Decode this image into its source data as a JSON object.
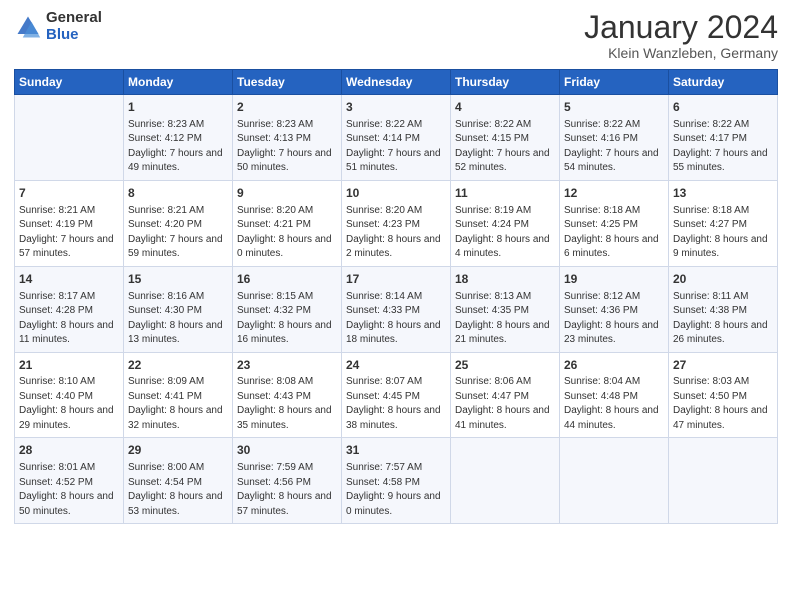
{
  "logo": {
    "general": "General",
    "blue": "Blue"
  },
  "title": "January 2024",
  "location": "Klein Wanzleben, Germany",
  "days": [
    "Sunday",
    "Monday",
    "Tuesday",
    "Wednesday",
    "Thursday",
    "Friday",
    "Saturday"
  ],
  "weeks": [
    [
      {
        "date": "",
        "sunrise": "",
        "sunset": "",
        "daylight": ""
      },
      {
        "date": "1",
        "sunrise": "Sunrise: 8:23 AM",
        "sunset": "Sunset: 4:12 PM",
        "daylight": "Daylight: 7 hours and 49 minutes."
      },
      {
        "date": "2",
        "sunrise": "Sunrise: 8:23 AM",
        "sunset": "Sunset: 4:13 PM",
        "daylight": "Daylight: 7 hours and 50 minutes."
      },
      {
        "date": "3",
        "sunrise": "Sunrise: 8:22 AM",
        "sunset": "Sunset: 4:14 PM",
        "daylight": "Daylight: 7 hours and 51 minutes."
      },
      {
        "date": "4",
        "sunrise": "Sunrise: 8:22 AM",
        "sunset": "Sunset: 4:15 PM",
        "daylight": "Daylight: 7 hours and 52 minutes."
      },
      {
        "date": "5",
        "sunrise": "Sunrise: 8:22 AM",
        "sunset": "Sunset: 4:16 PM",
        "daylight": "Daylight: 7 hours and 54 minutes."
      },
      {
        "date": "6",
        "sunrise": "Sunrise: 8:22 AM",
        "sunset": "Sunset: 4:17 PM",
        "daylight": "Daylight: 7 hours and 55 minutes."
      }
    ],
    [
      {
        "date": "7",
        "sunrise": "Sunrise: 8:21 AM",
        "sunset": "Sunset: 4:19 PM",
        "daylight": "Daylight: 7 hours and 57 minutes."
      },
      {
        "date": "8",
        "sunrise": "Sunrise: 8:21 AM",
        "sunset": "Sunset: 4:20 PM",
        "daylight": "Daylight: 7 hours and 59 minutes."
      },
      {
        "date": "9",
        "sunrise": "Sunrise: 8:20 AM",
        "sunset": "Sunset: 4:21 PM",
        "daylight": "Daylight: 8 hours and 0 minutes."
      },
      {
        "date": "10",
        "sunrise": "Sunrise: 8:20 AM",
        "sunset": "Sunset: 4:23 PM",
        "daylight": "Daylight: 8 hours and 2 minutes."
      },
      {
        "date": "11",
        "sunrise": "Sunrise: 8:19 AM",
        "sunset": "Sunset: 4:24 PM",
        "daylight": "Daylight: 8 hours and 4 minutes."
      },
      {
        "date": "12",
        "sunrise": "Sunrise: 8:18 AM",
        "sunset": "Sunset: 4:25 PM",
        "daylight": "Daylight: 8 hours and 6 minutes."
      },
      {
        "date": "13",
        "sunrise": "Sunrise: 8:18 AM",
        "sunset": "Sunset: 4:27 PM",
        "daylight": "Daylight: 8 hours and 9 minutes."
      }
    ],
    [
      {
        "date": "14",
        "sunrise": "Sunrise: 8:17 AM",
        "sunset": "Sunset: 4:28 PM",
        "daylight": "Daylight: 8 hours and 11 minutes."
      },
      {
        "date": "15",
        "sunrise": "Sunrise: 8:16 AM",
        "sunset": "Sunset: 4:30 PM",
        "daylight": "Daylight: 8 hours and 13 minutes."
      },
      {
        "date": "16",
        "sunrise": "Sunrise: 8:15 AM",
        "sunset": "Sunset: 4:32 PM",
        "daylight": "Daylight: 8 hours and 16 minutes."
      },
      {
        "date": "17",
        "sunrise": "Sunrise: 8:14 AM",
        "sunset": "Sunset: 4:33 PM",
        "daylight": "Daylight: 8 hours and 18 minutes."
      },
      {
        "date": "18",
        "sunrise": "Sunrise: 8:13 AM",
        "sunset": "Sunset: 4:35 PM",
        "daylight": "Daylight: 8 hours and 21 minutes."
      },
      {
        "date": "19",
        "sunrise": "Sunrise: 8:12 AM",
        "sunset": "Sunset: 4:36 PM",
        "daylight": "Daylight: 8 hours and 23 minutes."
      },
      {
        "date": "20",
        "sunrise": "Sunrise: 8:11 AM",
        "sunset": "Sunset: 4:38 PM",
        "daylight": "Daylight: 8 hours and 26 minutes."
      }
    ],
    [
      {
        "date": "21",
        "sunrise": "Sunrise: 8:10 AM",
        "sunset": "Sunset: 4:40 PM",
        "daylight": "Daylight: 8 hours and 29 minutes."
      },
      {
        "date": "22",
        "sunrise": "Sunrise: 8:09 AM",
        "sunset": "Sunset: 4:41 PM",
        "daylight": "Daylight: 8 hours and 32 minutes."
      },
      {
        "date": "23",
        "sunrise": "Sunrise: 8:08 AM",
        "sunset": "Sunset: 4:43 PM",
        "daylight": "Daylight: 8 hours and 35 minutes."
      },
      {
        "date": "24",
        "sunrise": "Sunrise: 8:07 AM",
        "sunset": "Sunset: 4:45 PM",
        "daylight": "Daylight: 8 hours and 38 minutes."
      },
      {
        "date": "25",
        "sunrise": "Sunrise: 8:06 AM",
        "sunset": "Sunset: 4:47 PM",
        "daylight": "Daylight: 8 hours and 41 minutes."
      },
      {
        "date": "26",
        "sunrise": "Sunrise: 8:04 AM",
        "sunset": "Sunset: 4:48 PM",
        "daylight": "Daylight: 8 hours and 44 minutes."
      },
      {
        "date": "27",
        "sunrise": "Sunrise: 8:03 AM",
        "sunset": "Sunset: 4:50 PM",
        "daylight": "Daylight: 8 hours and 47 minutes."
      }
    ],
    [
      {
        "date": "28",
        "sunrise": "Sunrise: 8:01 AM",
        "sunset": "Sunset: 4:52 PM",
        "daylight": "Daylight: 8 hours and 50 minutes."
      },
      {
        "date": "29",
        "sunrise": "Sunrise: 8:00 AM",
        "sunset": "Sunset: 4:54 PM",
        "daylight": "Daylight: 8 hours and 53 minutes."
      },
      {
        "date": "30",
        "sunrise": "Sunrise: 7:59 AM",
        "sunset": "Sunset: 4:56 PM",
        "daylight": "Daylight: 8 hours and 57 minutes."
      },
      {
        "date": "31",
        "sunrise": "Sunrise: 7:57 AM",
        "sunset": "Sunset: 4:58 PM",
        "daylight": "Daylight: 9 hours and 0 minutes."
      },
      {
        "date": "",
        "sunrise": "",
        "sunset": "",
        "daylight": ""
      },
      {
        "date": "",
        "sunrise": "",
        "sunset": "",
        "daylight": ""
      },
      {
        "date": "",
        "sunrise": "",
        "sunset": "",
        "daylight": ""
      }
    ]
  ]
}
